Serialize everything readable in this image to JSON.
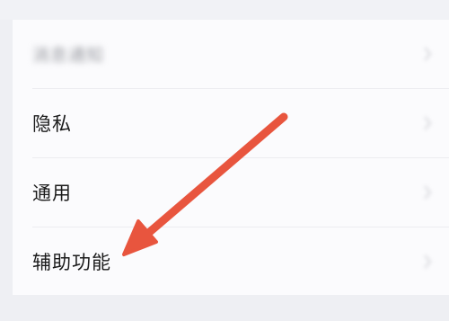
{
  "settings_list": {
    "items": [
      {
        "label": "消息通知",
        "blurred": true,
        "icon": "chevron-right-icon"
      },
      {
        "label": "隐私",
        "blurred": false,
        "icon": "chevron-right-icon"
      },
      {
        "label": "通用",
        "blurred": false,
        "icon": "chevron-right-icon"
      },
      {
        "label": "辅助功能",
        "blurred": false,
        "icon": "chevron-right-icon"
      }
    ]
  },
  "annotation": {
    "arrow_color": "#e8553e",
    "target": "辅助功能"
  },
  "colors": {
    "background": "#eeeff3",
    "card": "#fbfbfd",
    "text": "#1b1b1b"
  }
}
